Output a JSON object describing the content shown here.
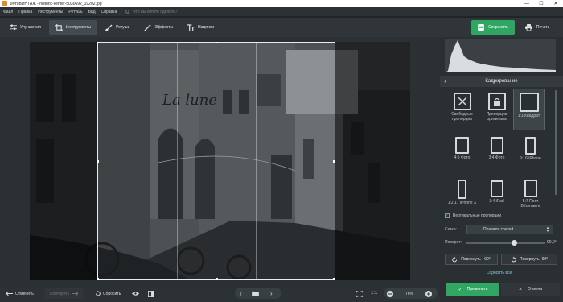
{
  "titlebar": {
    "title": "ФотоВИНТАЖ - historic-center-5030692_19202.jpg"
  },
  "menu": {
    "items": [
      "Файл",
      "Правка",
      "Инструменты",
      "Ретушь",
      "Вид",
      "Справка"
    ],
    "search_placeholder": "Что вы хотите сделать?"
  },
  "toolbar": {
    "tools": [
      "Улучшения",
      "Инструменты",
      "Ретушь",
      "Эффекты",
      "Надписи"
    ],
    "active": "Инструменты",
    "save": "Сохранить",
    "print": "Печать"
  },
  "panel": {
    "title": "Кадрирование",
    "presets": [
      {
        "label": "Свободные пропорции",
        "icon": "free-crop-icon"
      },
      {
        "label": "Пропорции оригинала",
        "icon": "original-ratio-icon"
      },
      {
        "label": "1:1 Квадрат",
        "icon": "square-icon",
        "selected": true
      },
      {
        "label": "4:5 Фото",
        "icon": "portrait-45-icon"
      },
      {
        "label": "3:4 Фото",
        "icon": "portrait-34-icon"
      },
      {
        "label": "9:16 iPhone",
        "icon": "portrait-916-icon"
      },
      {
        "label": "1:2.17 iPhone X",
        "icon": "iphonex-icon"
      },
      {
        "label": "3:4 iPad",
        "icon": "ipad-icon"
      },
      {
        "label": "5:7 Пост ВКонтакте",
        "icon": "vk-icon"
      }
    ],
    "vertical_label": "Вертикальные пропорции",
    "vertical_checked": true,
    "grid_label": "Сетка:",
    "grid_value": "Правило третей",
    "rotate_label": "Поворот:",
    "rotate_value": "90,0°",
    "rotate_fraction": 0.5,
    "rotate_plus": "Повернуть +90°",
    "rotate_minus": "Повернуть -90°",
    "reset_all": "Сбросить все",
    "apply": "Применить",
    "cancel": "Отмена"
  },
  "bottombar": {
    "undo": "Отменить",
    "redo": "Повторить",
    "reset": "Сбросить",
    "ratio": "1:1",
    "zoom": "76%"
  }
}
